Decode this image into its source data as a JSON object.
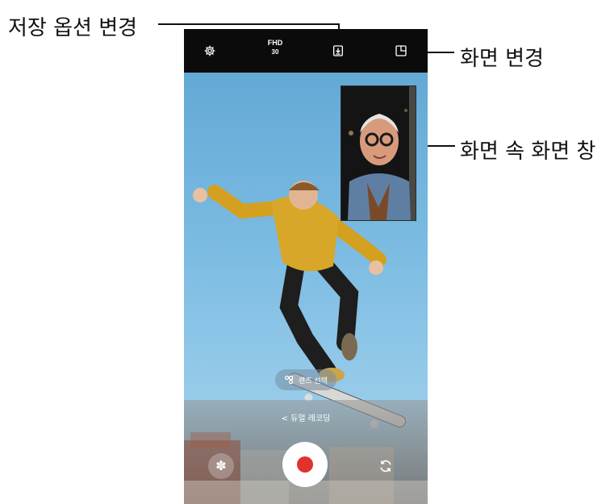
{
  "callouts": {
    "save_options": "저장 옵션 변경",
    "change_view": "화면 변경",
    "pip_window": "화면 속 화면 창"
  },
  "camera": {
    "top_bar": {
      "settings_icon": "gear-icon",
      "resolution": "FHD",
      "fps": "30",
      "save_icon": "download-icon",
      "view_icon": "layout-icon"
    },
    "lens_select_label": "렌즈 선택",
    "mode_label": "< 듀얼 레코딩",
    "record_color": "#e0322e"
  }
}
